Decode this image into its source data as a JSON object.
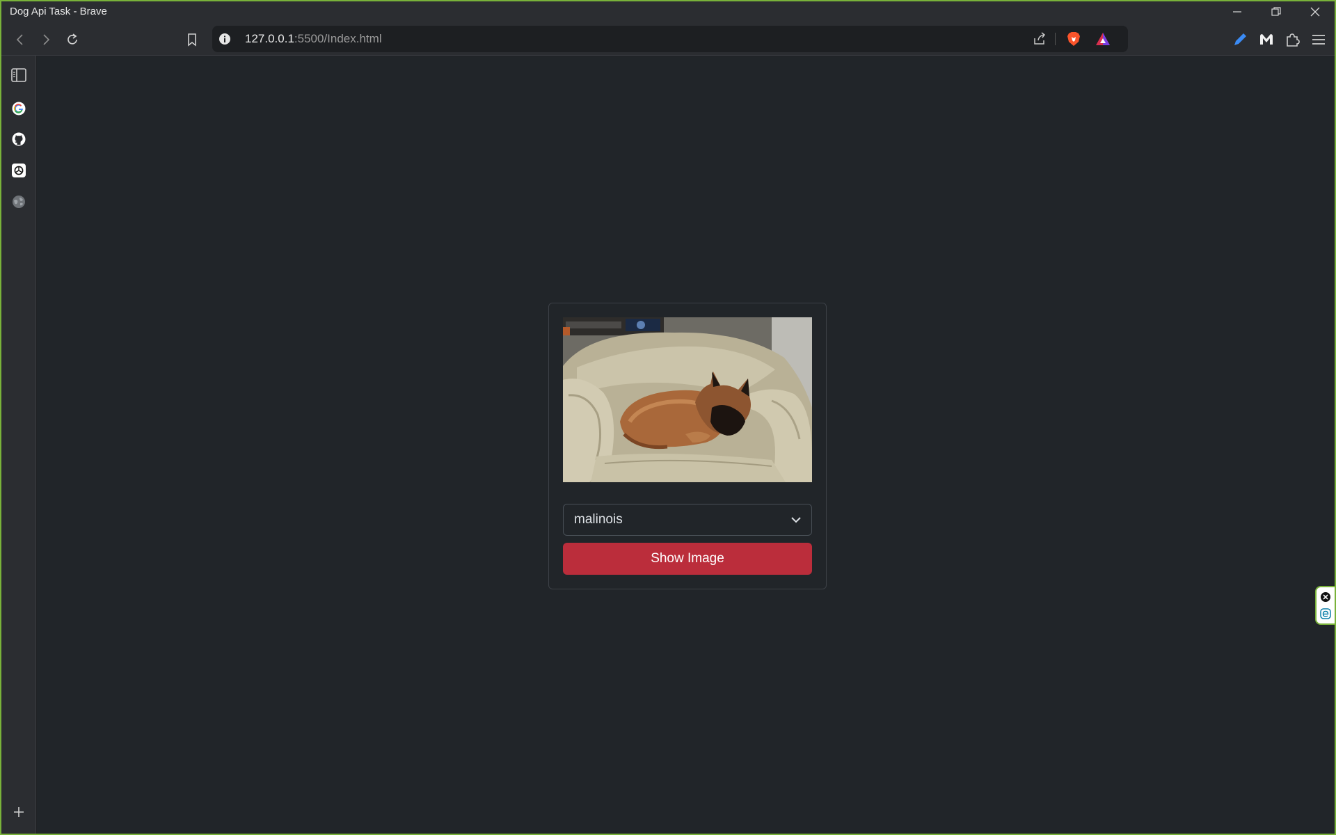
{
  "window": {
    "title": "Dog Api Task - Brave"
  },
  "toolbar": {
    "url_host": "127.0.0.1",
    "url_rest": ":5500/Index.html"
  },
  "card": {
    "breed_selected": "malinois",
    "show_button_label": "Show Image",
    "photo_alt": "malinois dog sleeping on a leather armchair"
  },
  "colors": {
    "page_bg": "#212529",
    "button_danger": "#bb2d3b",
    "frame_accent": "#79b23a"
  },
  "sidebar": {
    "items": [
      {
        "icon": "sidebar-panel-icon"
      },
      {
        "icon": "google-icon"
      },
      {
        "icon": "github-icon"
      },
      {
        "icon": "chatgpt-icon"
      },
      {
        "icon": "globe-icon"
      },
      {
        "icon": "add-icon"
      }
    ]
  }
}
